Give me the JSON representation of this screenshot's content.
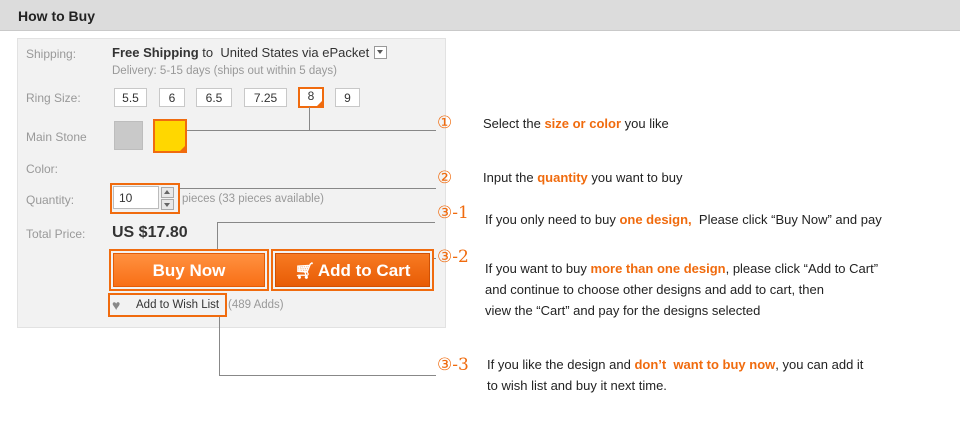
{
  "header": {
    "title": "How to Buy"
  },
  "product": {
    "shipping_label": "Shipping:",
    "shipping_bold": "Free Shipping",
    "shipping_rest": " to  United States via ePacket",
    "delivery": "Delivery: 5-15 days (ships out within 5 days)",
    "ring_size_label": "Ring Size:",
    "sizes": [
      "5.5",
      "6",
      "6.5",
      "7.25",
      "8",
      "9"
    ],
    "selected_size": "8",
    "main_stone_label": "Main Stone",
    "color_label": "Color:",
    "stone_colors": [
      "#c9c9c9",
      "#ffd700"
    ],
    "quantity_label": "Quantity:",
    "quantity_value": "10",
    "availability": "pieces (33 pieces available)",
    "total_label": "Total Price:",
    "total_price": "US $17.80",
    "buy_now": "Buy Now",
    "add_to_cart": "Add to Cart",
    "wish_list": "Add to Wish List",
    "wish_adds": "(489 Adds)"
  },
  "annotations": [
    {
      "marker": "①",
      "parts": [
        "Select the ",
        "size or color",
        " you like"
      ]
    },
    {
      "marker": "②",
      "parts": [
        "Input the ",
        "quantity",
        " you want to buy"
      ]
    },
    {
      "marker": "③-1",
      "parts": [
        "If you only need to buy ",
        "one design,",
        "  Please click “Buy Now” and pay"
      ]
    },
    {
      "marker": "③-2",
      "parts": [
        "If you want to buy ",
        "more than one design",
        ", please click “Add to Cart”"
      ],
      "line2": "and continue to choose other designs and add to cart, then",
      "line3": "view the “Cart” and pay for the designs selected"
    },
    {
      "marker": "③-3",
      "parts": [
        "If you like the design and ",
        "don’t  want to buy now",
        ", you can add it"
      ],
      "line2": "to wish list and buy it next time."
    }
  ],
  "colors": {
    "accent": "#f06b0e",
    "panel": "#f2f2f2",
    "header": "#dcdcdc"
  }
}
